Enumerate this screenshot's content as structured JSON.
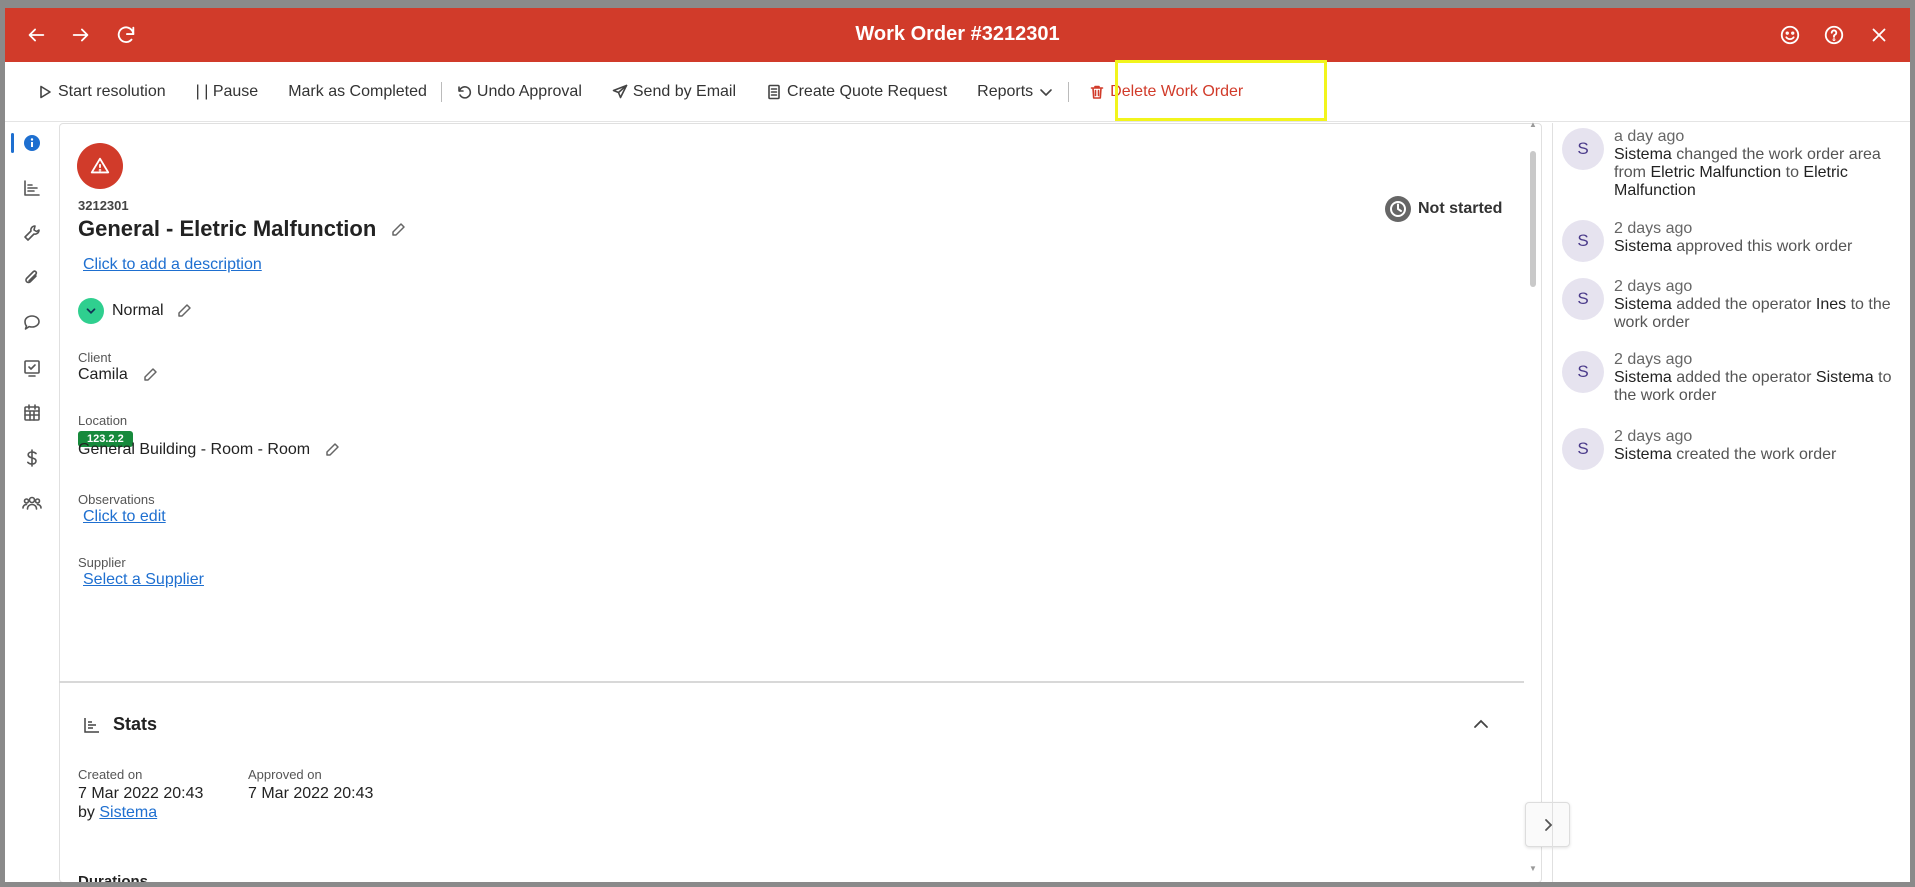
{
  "window": {
    "title": "Work Order #3212301",
    "accent": "#d13b2a"
  },
  "toolbar": {
    "start_resolution": "Start resolution",
    "pause": "| | Pause",
    "mark_completed": "Mark as Completed",
    "undo_approval": "Undo Approval",
    "send_email": "Send by Email",
    "create_quote": "Create Quote Request",
    "reports": "Reports",
    "delete": "Delete Work Order"
  },
  "work_order": {
    "id": "3212301",
    "title": "General - Eletric Malfunction",
    "description_link": "Click to add a description",
    "status": "Not started",
    "priority": "Normal",
    "client_label": "Client",
    "client": "Camila",
    "location_label": "Location",
    "location_code": "123.2.2",
    "location": "General Building - Room - Room",
    "observations_label": "Observations",
    "observations_link": "Click to edit",
    "supplier_label": "Supplier",
    "supplier_link": "Select a Supplier"
  },
  "stats": {
    "title": "Stats",
    "created_label": "Created on",
    "created_date": "7 Mar 2022 20:43",
    "created_by_prefix": "by",
    "created_by": "Sistema",
    "approved_label": "Approved on",
    "approved_date": "7 Mar 2022 20:43",
    "durations_title": "Durations"
  },
  "activity": [
    {
      "avatar": "S",
      "time": "a day ago",
      "actor": "Sistema",
      "t1": " changed the work order area from ",
      "e1": "Eletric Malfunction",
      "t2": " to ",
      "e2": "Eletric Malfunction",
      "t3": ""
    },
    {
      "avatar": "S",
      "time": "2 days ago",
      "actor": "Sistema",
      "t1": " approved this work order",
      "e1": "",
      "t2": "",
      "e2": "",
      "t3": ""
    },
    {
      "avatar": "S",
      "time": "2 days ago",
      "actor": "Sistema",
      "t1": " added the operator ",
      "e1": "Ines",
      "t2": " to the work order",
      "e2": "",
      "t3": ""
    },
    {
      "avatar": "S",
      "time": "2 days ago",
      "actor": "Sistema",
      "t1": " added the operator ",
      "e1": "Sistema",
      "t2": " to the work order",
      "e2": "",
      "t3": ""
    },
    {
      "avatar": "S",
      "time": "2 days ago",
      "actor": "Sistema",
      "t1": " created the work order",
      "e1": "",
      "t2": "",
      "e2": "",
      "t3": ""
    }
  ]
}
